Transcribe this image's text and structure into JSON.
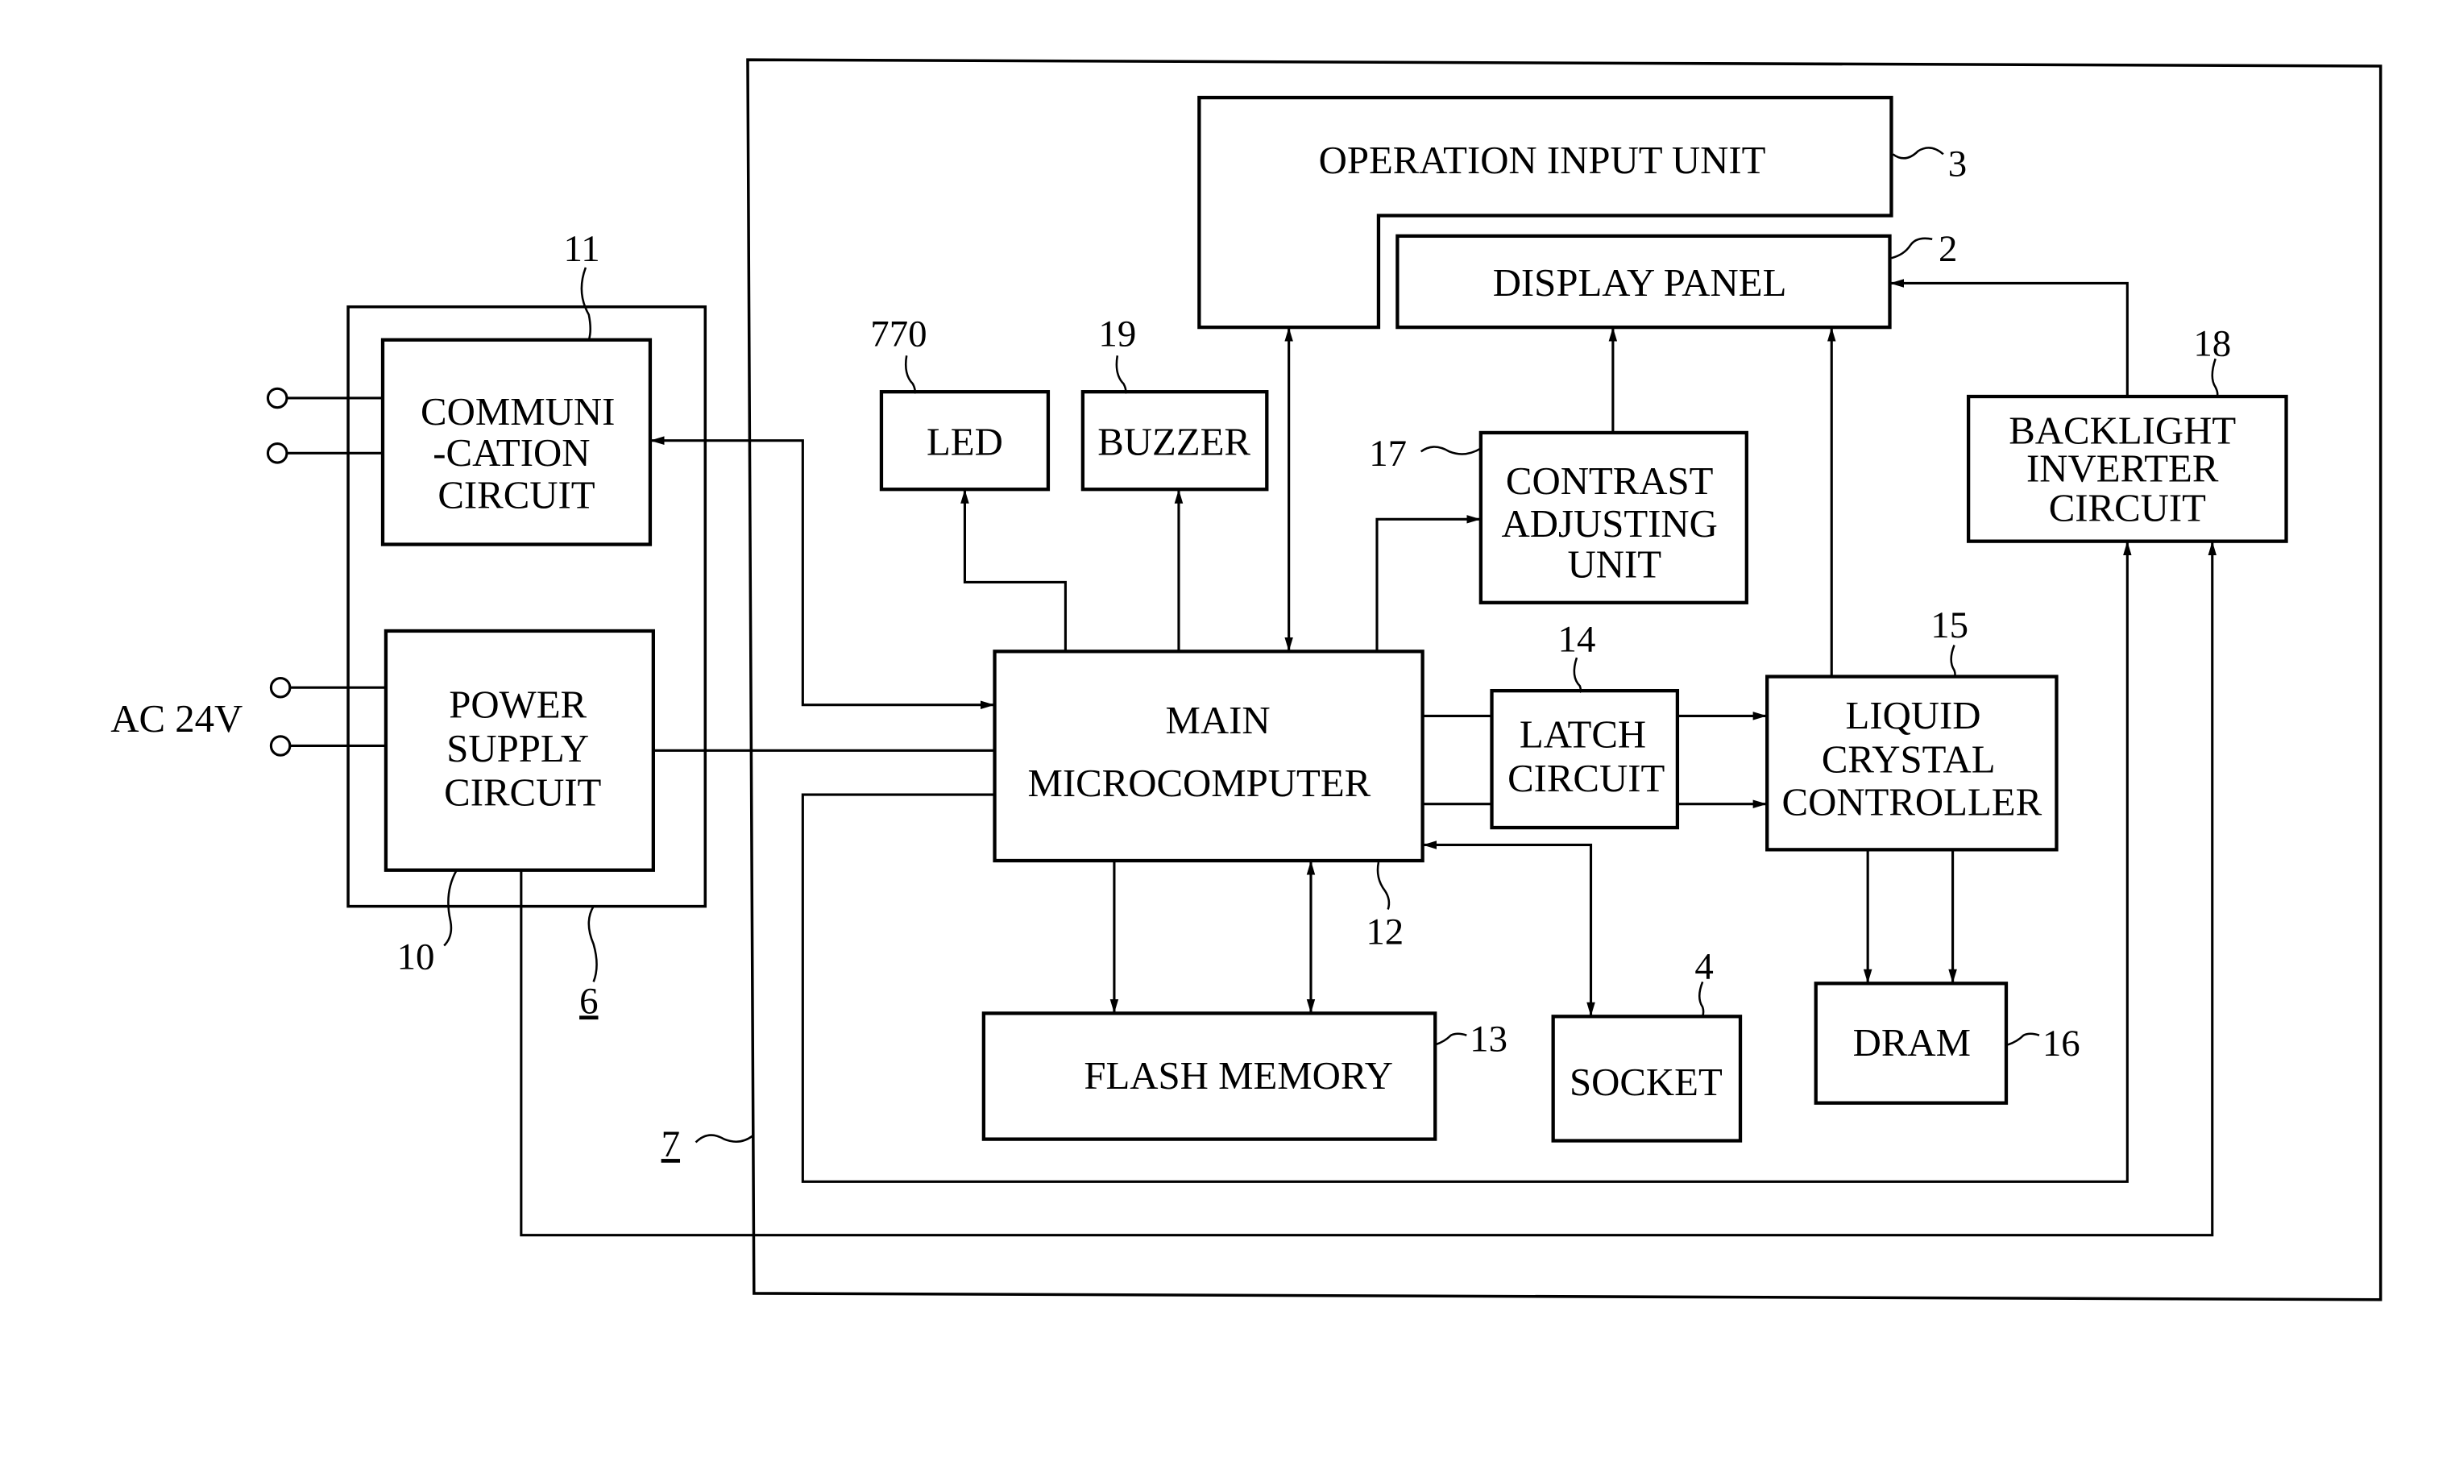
{
  "figure": {
    "colors": {
      "line": "#000000",
      "background": "#ffffff"
    },
    "external_label": "AC 24V",
    "blocks": {
      "operation_input": {
        "lines": [
          "OPERATION INPUT UNIT"
        ],
        "ref": "3"
      },
      "display_panel": {
        "lines": [
          "DISPLAY PANEL"
        ],
        "ref": "2"
      },
      "communication": {
        "lines": [
          "COMMUNI",
          "-CATION",
          "CIRCUIT"
        ],
        "ref": "11"
      },
      "power_supply": {
        "lines": [
          "POWER",
          "SUPPLY",
          "CIRCUIT"
        ],
        "ref": "10"
      },
      "led": {
        "lines": [
          "LED"
        ],
        "ref": "770"
      },
      "buzzer": {
        "lines": [
          "BUZZER"
        ],
        "ref": "19"
      },
      "contrast": {
        "lines": [
          "CONTRAST",
          "ADJUSTING",
          "UNIT"
        ],
        "ref": "17"
      },
      "backlight": {
        "lines": [
          "BACKLIGHT",
          "INVERTER",
          "CIRCUIT"
        ],
        "ref": "18"
      },
      "main_micro": {
        "lines": [
          "MAIN",
          "MICROCOMPUTER"
        ],
        "ref": "12"
      },
      "latch": {
        "lines": [
          "LATCH",
          "CIRCUIT"
        ],
        "ref": "14"
      },
      "lcd_controller": {
        "lines": [
          "LIQUID",
          "CRYSTAL",
          "CONTROLLER"
        ],
        "ref": "15"
      },
      "flash": {
        "lines": [
          "FLASH MEMORY"
        ],
        "ref": "13"
      },
      "socket": {
        "lines": [
          "SOCKET"
        ],
        "ref": "4"
      },
      "dram": {
        "lines": [
          "DRAM"
        ],
        "ref": "16"
      }
    },
    "enclosures": {
      "power_unit": {
        "ref": "6"
      },
      "main_unit": {
        "ref": "7"
      }
    }
  }
}
